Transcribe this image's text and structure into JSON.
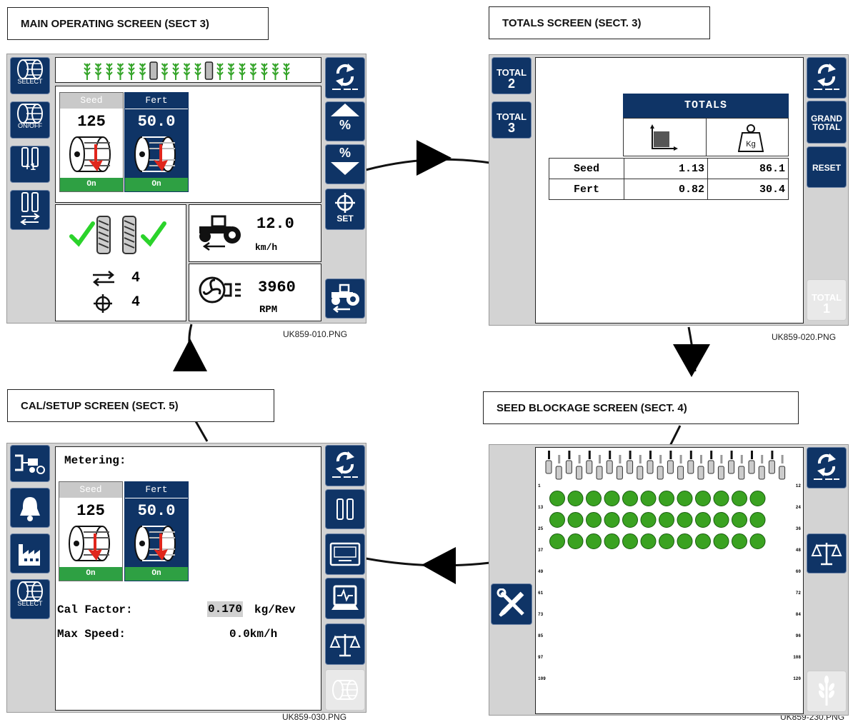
{
  "titles": {
    "main": "MAIN OPERATING SCREEN (SECT 3)",
    "totals": "TOTALS SCREEN (SECT. 3)",
    "cal": "CAL/SETUP SCREEN (SECT. 5)",
    "blockage": "SEED BLOCKAGE SCREEN (SECT. 4)"
  },
  "captions": {
    "main": "UK859-010.PNG",
    "totals": "UK859-020.PNG",
    "cal": "UK859-030.PNG",
    "blockage": "UK859-230.PNG"
  },
  "main_screen": {
    "left_buttons": [
      "SELECT",
      "ON/OFF",
      "+1",
      ""
    ],
    "seed_label": "Seed",
    "fert_label": "Fert",
    "seed_rate": "125",
    "fert_rate": "50.0",
    "seed_status": "On",
    "fert_status": "On",
    "width_count": "4",
    "marker_count": "4",
    "speed_value": "12.0",
    "speed_unit": "km/h",
    "fan_value": "3960",
    "fan_unit": "RPM",
    "right_buttons": [
      "",
      "%",
      "%",
      "SET",
      ""
    ]
  },
  "totals_screen": {
    "left_buttons": [
      {
        "label": "TOTAL",
        "num": "2"
      },
      {
        "label": "TOTAL",
        "num": "3"
      }
    ],
    "table_title": "TOTALS",
    "weight_icon_label": "Kg",
    "rows": [
      {
        "name": "Seed",
        "area": "1.13",
        "weight": "86.1"
      },
      {
        "name": "Fert",
        "area": "0.82",
        "weight": "30.4"
      }
    ],
    "right_buttons": [
      "",
      "GRAND TOTAL",
      "RESET"
    ],
    "total1_label": "TOTAL",
    "total1_num": "1"
  },
  "cal_screen": {
    "heading": "Metering:",
    "seed_label": "Seed",
    "fert_label": "Fert",
    "seed_rate": "125",
    "fert_rate": "50.0",
    "seed_status": "On",
    "fert_status": "On",
    "cal_factor_label": "Cal Factor:",
    "cal_factor_value": "0.170",
    "cal_factor_unit": "kg/Rev",
    "max_speed_label": "Max Speed:",
    "max_speed_value": "0.0km/h",
    "left_buttons": [
      "",
      "",
      "",
      "SELECT"
    ]
  },
  "blockage_screen": {
    "row_numbers_left": [
      "1",
      "13",
      "25",
      "37",
      "49",
      "61",
      "73",
      "85",
      "97",
      "109"
    ],
    "row_numbers_right": [
      "12",
      "24",
      "36",
      "48",
      "60",
      "72",
      "84",
      "96",
      "108",
      "120"
    ],
    "sensor_rows": 3,
    "sensors_per_row": 12,
    "sensor_color": "#3aa221"
  },
  "colors": {
    "button_blue": "#0f3466",
    "status_green": "#2ea043",
    "check_green": "#2bd32b",
    "arrow_red": "#e0261c"
  }
}
